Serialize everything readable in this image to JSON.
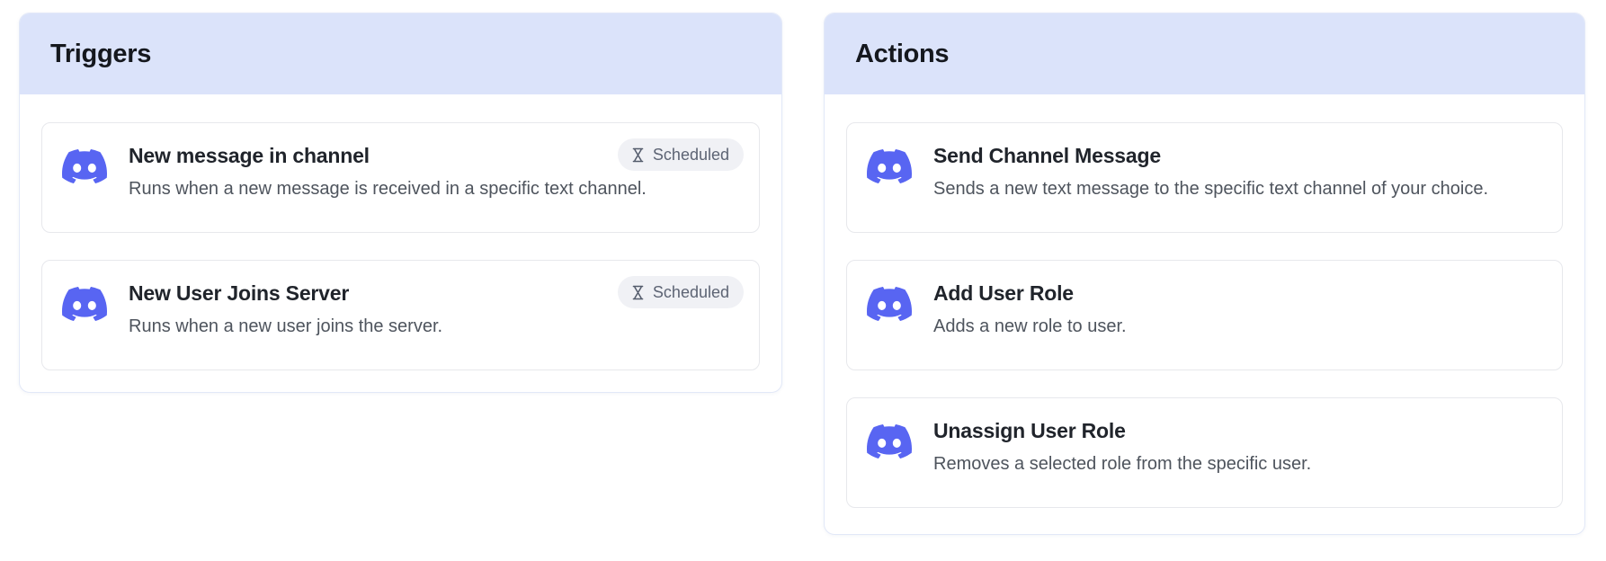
{
  "colors": {
    "header_bg": "#dbe3fa",
    "discord_brand": "#5865f2",
    "badge_bg": "#f0f1f5",
    "badge_text": "#5d6474",
    "card_border": "#e7e8ec",
    "panel_border": "#e2e8f8"
  },
  "icons": {
    "card_icon": "discord-icon",
    "badge_icon": "hourglass-icon"
  },
  "panels": [
    {
      "title": "Triggers",
      "items": [
        {
          "title": "New message in channel",
          "description": "Runs when a new message is received in a specific text channel.",
          "badge": "Scheduled"
        },
        {
          "title": "New User Joins Server",
          "description": "Runs when a new user joins the server.",
          "badge": "Scheduled"
        }
      ]
    },
    {
      "title": "Actions",
      "items": [
        {
          "title": "Send Channel Message",
          "description": "Sends a new text message to the specific text channel of your choice."
        },
        {
          "title": "Add User Role",
          "description": "Adds a new role to user."
        },
        {
          "title": "Unassign User Role",
          "description": "Removes a selected role from the specific user."
        }
      ]
    }
  ]
}
